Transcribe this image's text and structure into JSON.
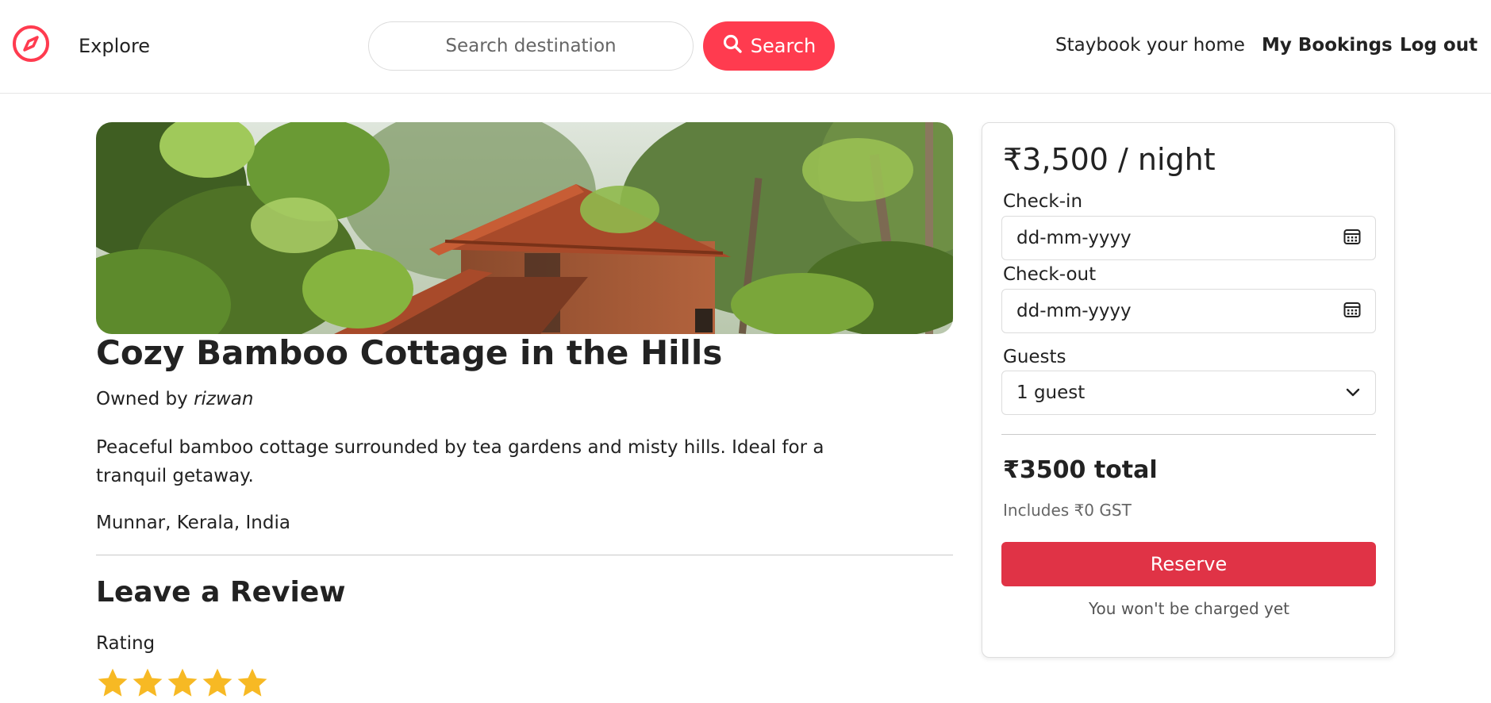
{
  "header": {
    "logo_icon": "compass-icon",
    "explore_label": "Explore",
    "search": {
      "placeholder": "Search destination",
      "value": ""
    },
    "search_button_label": "Search",
    "search_button_icon": "search-icon",
    "nav": {
      "host_label": "Staybook your home",
      "bookings_label": "My Bookings",
      "logout_label": "Log out"
    }
  },
  "listing": {
    "title": "Cozy Bamboo Cottage in the Hills",
    "owner_prefix": "Owned by",
    "owner_name": "rizwan",
    "description": "Peaceful bamboo cottage surrounded by tea gardens and misty hills. Ideal for a tranquil getaway.",
    "location": "Munnar, Kerala, India"
  },
  "review": {
    "heading": "Leave a Review",
    "rating_label": "Rating",
    "stars_total": 5,
    "stars_filled": 5
  },
  "booking": {
    "price": "₹3,500 / night",
    "checkin_label": "Check-in",
    "checkin_value": "dd-mm-yyyy",
    "checkout_label": "Check-out",
    "checkout_value": "dd-mm-yyyy",
    "guests_label": "Guests",
    "guests_value": "1 guest",
    "total": "₹3500 total",
    "gst_note": "Includes ₹0 GST",
    "reserve_label": "Reserve",
    "charge_note": "You won't be charged yet"
  },
  "colors": {
    "brand": "#ff3b4f",
    "reserve": "#e03346",
    "star": "#f7b924"
  }
}
